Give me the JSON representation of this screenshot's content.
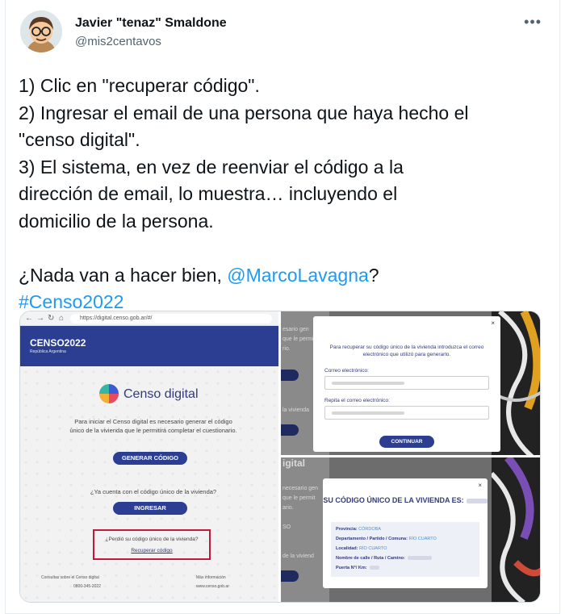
{
  "author": {
    "name": "Javier \"tenaz\" Smaldone",
    "handle": "@mis2centavos"
  },
  "more_icon": "more-horizontal-icon",
  "tweet": {
    "line1": "1) Clic en \"recuperar código\".",
    "line2": "2) Ingresar el email de una persona que haya hecho el",
    "line3": "\"censo digital\".",
    "line4": "3) El sistema, en vez de reenviar el código a la",
    "line5": "dirección de email, lo muestra… incluyendo el",
    "line6": "domicilio de la persona.",
    "line7_text": "¿Nada van a hacer bien, ",
    "line7_mention": "@MarcoLavagna",
    "line7_end": "?",
    "hashtag": "#Censo2022"
  },
  "colors": {
    "link": "#1d9bf0",
    "censo_blue": "#2c3e91",
    "highlight_red": "#c2183a"
  },
  "screenshot_left": {
    "url": "https://digital.censo.gob.ar/#/",
    "logo": "CENSO2022",
    "logo_sub": "República Argentina",
    "title": "Censo digital",
    "description": "Para iniciar el Censo digital es necesario generar el código único de la vivienda que le permitirá completar el cuestionario.",
    "generate_btn": "GENERAR CÓDIGO",
    "has_code_q": "¿Ya cuenta con el código único de la vivienda?",
    "ingresar_btn": "INGRESAR",
    "lost_code_q": "¿Perdió su código único de la vivienda?",
    "recover_link": "Recuperar código",
    "footer_left": "Consultas sobre el Censo digital",
    "footer_left_phone": "0800-345-2022",
    "footer_right": "Más información",
    "footer_right_url": "www.censo.gob.ar"
  },
  "screenshot_top_right": {
    "bg_text_1": "esario gen",
    "bg_text_2": "que le permit",
    "bg_text_3": "rio.",
    "bg_text_4": "la vivienda",
    "intro": "Para recuperar su código único de la vivienda introduzca el correo electrónico que utilizó para generarlo.",
    "email_label": "Correo electrónico:",
    "repeat_label": "Repita el correo electrónico:",
    "continue_btn": "CONTINUAR",
    "close": "×"
  },
  "screenshot_bottom_right": {
    "bg_title": "igital",
    "bg_text_1": "necesario gen",
    "bg_text_2": "que le permit",
    "bg_text_3": "ario.",
    "bg_text_4": "SO",
    "bg_text_5": "de la viviend",
    "title": "SU CÓDIGO ÚNICO DE LA VIVIENDA ES:",
    "provincia_label": "Provincia:",
    "provincia_value": "CÓRDOBA",
    "depto_label": "Departamento / Partido / Comuna:",
    "depto_value": "RÍO CUARTO",
    "localidad_label": "Localidad:",
    "localidad_value": "RÍO CUARTO",
    "calle_label": "Nombre de calle / Ruta / Camino:",
    "puerta_label": "Puerta N°/ Km:",
    "close": "×"
  }
}
